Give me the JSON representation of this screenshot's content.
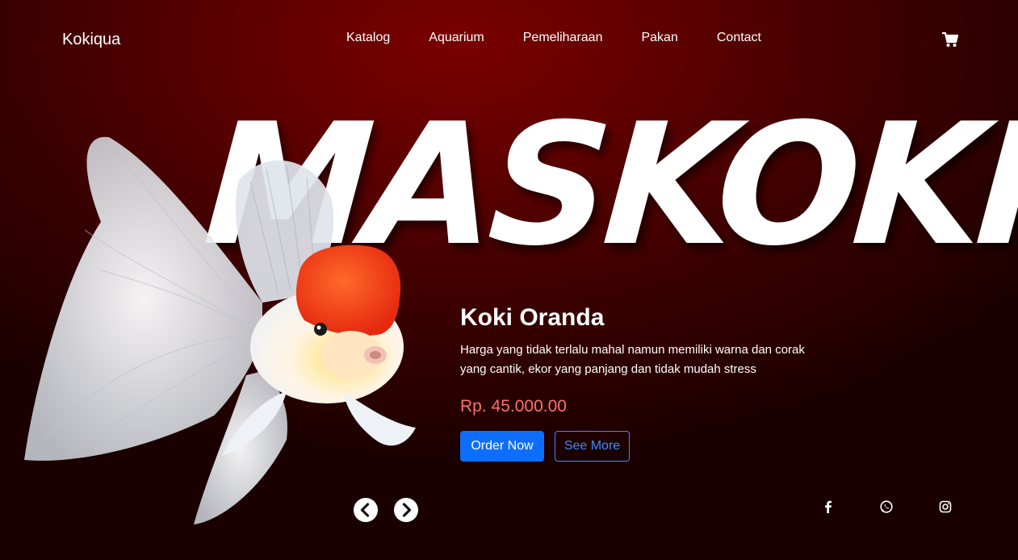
{
  "brand": "Kokiqua",
  "nav": {
    "items": [
      "Katalog",
      "Aquarium",
      "Pemeliharaan",
      "Pakan",
      "Contact"
    ],
    "cart_icon": "shopping-cart-icon"
  },
  "hero": {
    "title": "MASKOKI",
    "product_name": "Koki Oranda",
    "description": "Harga yang tidak terlalu mahal namun memiliki warna dan corak yang cantik, ekor yang panjang dan tidak mudah stress",
    "price": "Rp. 45.000.00",
    "order_label": "Order Now",
    "see_more_label": "See More"
  },
  "carousel": {
    "prev_icon": "chevron-left-icon",
    "next_icon": "chevron-right-icon"
  },
  "social": {
    "icons": [
      "facebook-icon",
      "whatsapp-icon",
      "instagram-icon"
    ]
  },
  "colors": {
    "accent_primary": "#0d6efd",
    "price": "#ff7070",
    "background_dark_red": "#5e0000"
  }
}
